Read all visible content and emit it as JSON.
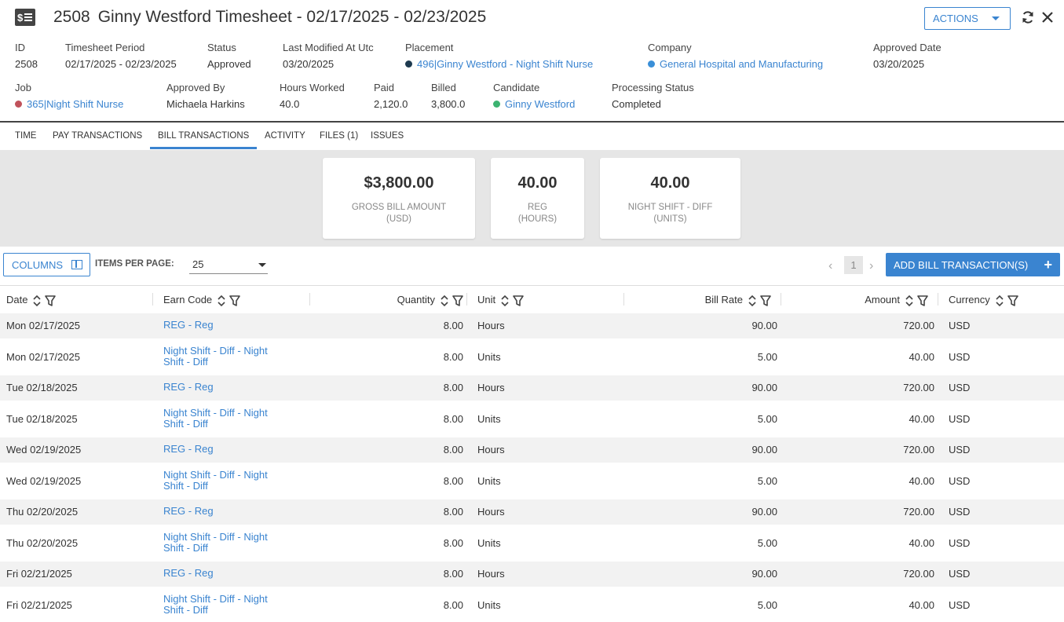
{
  "header": {
    "id": "2508",
    "title": "Ginny Westford Timesheet - 02/17/2025 - 02/23/2025",
    "actions_label": "ACTIONS"
  },
  "fields": {
    "id": {
      "label": "ID",
      "value": "2508"
    },
    "period": {
      "label": "Timesheet Period",
      "value": "02/17/2025 - 02/23/2025"
    },
    "status": {
      "label": "Status",
      "value": "Approved"
    },
    "modified": {
      "label": "Last Modified At Utc",
      "value": "03/20/2025"
    },
    "placement": {
      "label": "Placement",
      "value": "496|Ginny Westford - Night Shift Nurse",
      "dot_color": "#1d3a4f"
    },
    "company": {
      "label": "Company",
      "value": "General Hospital and Manufacturing",
      "dot_color": "#3a8fd8"
    },
    "approved_date": {
      "label": "Approved Date",
      "value": "03/20/2025"
    },
    "job": {
      "label": "Job",
      "value": "365|Night Shift Nurse",
      "dot_color": "#c0525b"
    },
    "approved_by": {
      "label": "Approved By",
      "value": "Michaela Harkins"
    },
    "hours_worked": {
      "label": "Hours Worked",
      "value": "40.0"
    },
    "paid": {
      "label": "Paid",
      "value": "2,120.0"
    },
    "billed": {
      "label": "Billed",
      "value": "3,800.0"
    },
    "candidate": {
      "label": "Candidate",
      "value": "Ginny Westford",
      "dot_color": "#3cb371"
    },
    "processing_status": {
      "label": "Processing Status",
      "value": "Completed"
    }
  },
  "tabs": [
    {
      "label": "TIME"
    },
    {
      "label": "PAY TRANSACTIONS"
    },
    {
      "label": "BILL TRANSACTIONS",
      "active": true
    },
    {
      "label": "ACTIVITY"
    },
    {
      "label": "FILES (1)"
    },
    {
      "label": "ISSUES"
    }
  ],
  "summary": [
    {
      "value": "$3,800.00",
      "line1": "GROSS BILL AMOUNT",
      "line2": "(USD)"
    },
    {
      "value": "40.00",
      "line1": "REG",
      "line2": "(HOURS)"
    },
    {
      "value": "40.00",
      "line1": "NIGHT SHIFT - DIFF",
      "line2": "(UNITS)"
    }
  ],
  "toolbar": {
    "columns_label": "COLUMNS",
    "items_per_page_label": "ITEMS PER PAGE:",
    "items_per_page_value": "25",
    "page": "1",
    "add_label": "ADD BILL TRANSACTION(S)"
  },
  "table": {
    "headers": {
      "date": "Date",
      "earn_code": "Earn Code",
      "quantity": "Quantity",
      "unit": "Unit",
      "bill_rate": "Bill Rate",
      "amount": "Amount",
      "currency": "Currency"
    },
    "rows": [
      {
        "date": "Mon 02/17/2025",
        "earn1": "REG - Reg",
        "earn2": "",
        "quantity": "8.00",
        "unit": "Hours",
        "bill_rate": "90.00",
        "amount": "720.00",
        "currency": "USD"
      },
      {
        "date": "Mon 02/17/2025",
        "earn1": "Night Shift - Diff - Night",
        "earn2": "Shift - Diff",
        "quantity": "8.00",
        "unit": "Units",
        "bill_rate": "5.00",
        "amount": "40.00",
        "currency": "USD"
      },
      {
        "date": "Tue 02/18/2025",
        "earn1": "REG - Reg",
        "earn2": "",
        "quantity": "8.00",
        "unit": "Hours",
        "bill_rate": "90.00",
        "amount": "720.00",
        "currency": "USD"
      },
      {
        "date": "Tue 02/18/2025",
        "earn1": "Night Shift - Diff - Night",
        "earn2": "Shift - Diff",
        "quantity": "8.00",
        "unit": "Units",
        "bill_rate": "5.00",
        "amount": "40.00",
        "currency": "USD"
      },
      {
        "date": "Wed 02/19/2025",
        "earn1": "REG - Reg",
        "earn2": "",
        "quantity": "8.00",
        "unit": "Hours",
        "bill_rate": "90.00",
        "amount": "720.00",
        "currency": "USD"
      },
      {
        "date": "Wed 02/19/2025",
        "earn1": "Night Shift - Diff - Night",
        "earn2": "Shift - Diff",
        "quantity": "8.00",
        "unit": "Units",
        "bill_rate": "5.00",
        "amount": "40.00",
        "currency": "USD"
      },
      {
        "date": "Thu 02/20/2025",
        "earn1": "REG - Reg",
        "earn2": "",
        "quantity": "8.00",
        "unit": "Hours",
        "bill_rate": "90.00",
        "amount": "720.00",
        "currency": "USD"
      },
      {
        "date": "Thu 02/20/2025",
        "earn1": "Night Shift - Diff - Night",
        "earn2": "Shift - Diff",
        "quantity": "8.00",
        "unit": "Units",
        "bill_rate": "5.00",
        "amount": "40.00",
        "currency": "USD"
      },
      {
        "date": "Fri 02/21/2025",
        "earn1": "REG - Reg",
        "earn2": "",
        "quantity": "8.00",
        "unit": "Hours",
        "bill_rate": "90.00",
        "amount": "720.00",
        "currency": "USD"
      },
      {
        "date": "Fri 02/21/2025",
        "earn1": "Night Shift - Diff - Night",
        "earn2": "Shift - Diff",
        "quantity": "8.00",
        "unit": "Units",
        "bill_rate": "5.00",
        "amount": "40.00",
        "currency": "USD"
      }
    ]
  }
}
